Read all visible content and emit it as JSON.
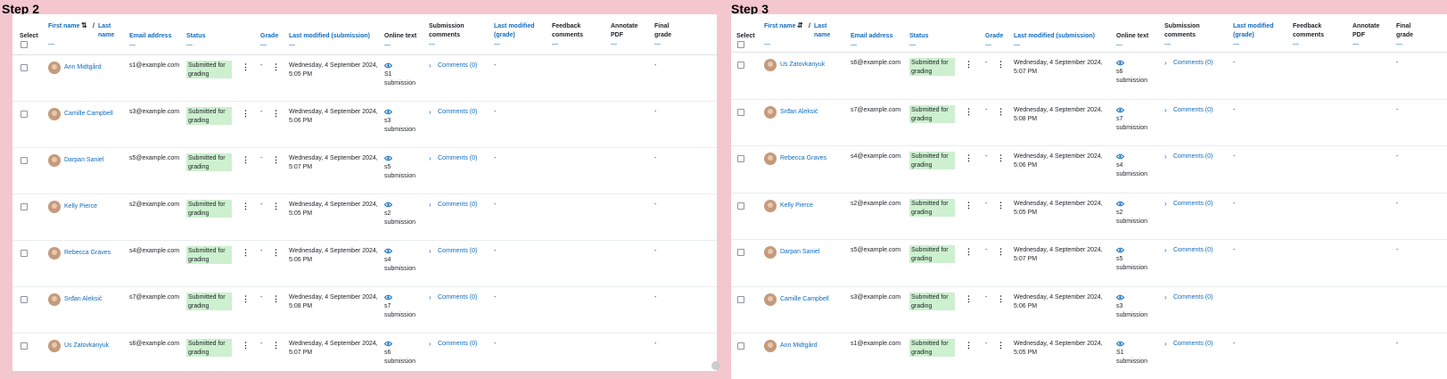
{
  "steps": [
    {
      "title": "Step 2",
      "headers": {
        "select": "Select",
        "first_name": "First name",
        "last_name": "Last name",
        "separator": "/",
        "email": "Email address",
        "status": "Status",
        "grade": "Grade",
        "last_modified_submission": "Last modified (submission)",
        "online_text": "Online text",
        "submission_comments": "Submission comments",
        "last_modified_grade": "Last modified (grade)",
        "feedback_comments": "Feedback comments",
        "annotate_pdf": "Annotate PDF",
        "final_grade": "Final grade",
        "dash": "—",
        "sort_icon": "sort-ascending-icon"
      },
      "rows": [
        {
          "name": "Ann Midtgård",
          "email": "s1@example.com",
          "status": "Submitted for grading",
          "grade": "-",
          "modified": "Wednesday, 4 September 2024, 5:05 PM",
          "online": "S1 submission",
          "comments": "Comments (0)",
          "lm_grade": "-",
          "final": "-"
        },
        {
          "name": "Camille Campbell",
          "email": "s3@example.com",
          "status": "Submitted for grading",
          "grade": "-",
          "modified": "Wednesday, 4 September 2024, 5:06 PM",
          "online": "s3 submission",
          "comments": "Comments (0)",
          "lm_grade": "-",
          "final": "-"
        },
        {
          "name": "Darpan Saniel",
          "email": "s5@example.com",
          "status": "Submitted for grading",
          "grade": "-",
          "modified": "Wednesday, 4 September 2024, 5:07 PM",
          "online": "s5 submission",
          "comments": "Comments (0)",
          "lm_grade": "-",
          "final": "-"
        },
        {
          "name": "Kelly Pierce",
          "email": "s2@example.com",
          "status": "Submitted for grading",
          "grade": "-",
          "modified": "Wednesday, 4 September 2024, 5:05 PM",
          "online": "s2 submission",
          "comments": "Comments (0)",
          "lm_grade": "-",
          "final": "-"
        },
        {
          "name": "Rebecca Graves",
          "email": "s4@example.com",
          "status": "Submitted for grading",
          "grade": "-",
          "modified": "Wednesday, 4 September 2024, 5:06 PM",
          "online": "s4 submission",
          "comments": "Comments (0)",
          "lm_grade": "-",
          "final": "-"
        },
        {
          "name": "Srđan Aleksić",
          "email": "s7@example.com",
          "status": "Submitted for grading",
          "grade": "-",
          "modified": "Wednesday, 4 September 2024, 5:08 PM",
          "online": "s7 submission",
          "comments": "Comments (0)",
          "lm_grade": "-",
          "final": "-"
        },
        {
          "name": "Us Zatovkanyuk",
          "email": "s6@example.com",
          "status": "Submitted for grading",
          "grade": "-",
          "modified": "Wednesday, 4 September 2024, 5:07 PM",
          "online": "s6 submission",
          "comments": "Comments (0)",
          "lm_grade": "-",
          "final": "-"
        }
      ]
    },
    {
      "title": "Step 3",
      "headers": {
        "select": "Select",
        "first_name": "First name",
        "last_name": "Last name",
        "separator": "/",
        "email": "Email address",
        "status": "Status",
        "grade": "Grade",
        "last_modified_submission": "Last modified (submission)",
        "online_text": "Online text",
        "submission_comments": "Submission comments",
        "last_modified_grade": "Last modified (grade)",
        "feedback_comments": "Feedback comments",
        "annotate_pdf": "Annotate PDF",
        "final_grade": "Final grade",
        "dash": "—",
        "sort_icon": "sort-descending-icon"
      },
      "rows": [
        {
          "name": "Us Zatovkanyuk",
          "email": "s6@example.com",
          "status": "Submitted for grading",
          "grade": "-",
          "modified": "Wednesday, 4 September 2024, 5:07 PM",
          "online": "s6 submission",
          "comments": "Comments (0)",
          "lm_grade": "-",
          "final": "-"
        },
        {
          "name": "Srđan Aleksić",
          "email": "s7@example.com",
          "status": "Submitted for grading",
          "grade": "-",
          "modified": "Wednesday, 4 September 2024, 5:08 PM",
          "online": "s7 submission",
          "comments": "Comments (0)",
          "lm_grade": "-",
          "final": "-"
        },
        {
          "name": "Rebecca Graves",
          "email": "s4@example.com",
          "status": "Submitted for grading",
          "grade": "-",
          "modified": "Wednesday, 4 September 2024, 5:06 PM",
          "online": "s4 submission",
          "comments": "Comments (0)",
          "lm_grade": "-",
          "final": "-"
        },
        {
          "name": "Kelly Pierce",
          "email": "s2@example.com",
          "status": "Submitted for grading",
          "grade": "-",
          "modified": "Wednesday, 4 September 2024, 5:05 PM",
          "online": "s2 submission",
          "comments": "Comments (0)",
          "lm_grade": "-",
          "final": "-"
        },
        {
          "name": "Darpan Saniel",
          "email": "s5@example.com",
          "status": "Submitted for grading",
          "grade": "-",
          "modified": "Wednesday, 4 September 2024, 5:07 PM",
          "online": "s5 submission",
          "comments": "Comments (0)",
          "lm_grade": "-",
          "final": "-"
        },
        {
          "name": "Camille Campbell",
          "email": "s3@example.com",
          "status": "Submitted for grading",
          "grade": "-",
          "modified": "Wednesday, 4 September 2024, 5:06 PM",
          "online": "s3 submission",
          "comments": "Comments (0)",
          "lm_grade": "",
          "final": ""
        },
        {
          "name": "Ann Midtgård",
          "email": "s1@example.com",
          "status": "Submitted for grading",
          "grade": "-",
          "modified": "Wednesday, 4 September 2024, 5:05 PM",
          "online": "S1 submission",
          "comments": "Comments (0)",
          "lm_grade": "-",
          "final": "-"
        }
      ]
    }
  ],
  "colors": {
    "link": "#0f6cbf",
    "badge": "#cdf0cf",
    "background": "#f4c7cf"
  }
}
